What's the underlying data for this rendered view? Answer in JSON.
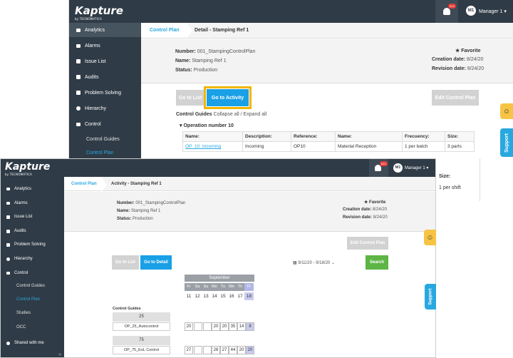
{
  "brand": {
    "logo": "Kapture",
    "tagline": "by TECNOMATICA"
  },
  "notifications": {
    "count": "613"
  },
  "user": {
    "initials": "M1",
    "name": "Manager 1",
    "caret": "▾"
  },
  "sidebar": {
    "items": [
      "Analytics",
      "Alarms",
      "Issue List",
      "Audits",
      "Problem Solving",
      "Hierarchy",
      "Control"
    ],
    "control_sub": [
      "Control Guides",
      "Control Plan",
      "Studies",
      "OCC"
    ],
    "extra": "Shared with me",
    "collapse": "«"
  },
  "back": {
    "breadcrumb": {
      "tab": "Control Plan",
      "current": "Detail - Stamping Ref 1"
    },
    "info": {
      "number_label": "Number:",
      "number": "001_StampingControlPlan",
      "name_label": "Name:",
      "name": "Stamping Ref 1",
      "status_label": "Status:",
      "status": "Production",
      "favorite": "Favorite",
      "creation_label": "Creation date:",
      "creation": "8/24/20",
      "revision_label": "Revision date:",
      "revision": "8/24/20"
    },
    "buttons": {
      "go_to_list": "Go to List",
      "go_to_activity": "Go to Activity",
      "edit": "Edit Control Plan"
    },
    "guides_header": {
      "title": "Control Guides",
      "toggle": "Collapse all / Expand all"
    },
    "operation": "Operation number 10",
    "table": {
      "headers": [
        "Name:",
        "Description:",
        "Reference:",
        "Name:",
        "Frecuency:",
        "Size:"
      ],
      "row": [
        "OP_10_Incoming",
        "Incoming",
        "OP10",
        "Material Reception",
        "1 per batch",
        "3 parts"
      ]
    },
    "peek": {
      "size": "Size:",
      "shift": "1 per shift"
    }
  },
  "front": {
    "breadcrumb": {
      "tab": "Control Plan",
      "current": "Activity - Stamping Ref 1"
    },
    "info": {
      "number_label": "Number:",
      "number": "001_StampingControlPlan",
      "name_label": "Name:",
      "name": "Stamping Ref 1",
      "status_label": "Status:",
      "status": "Production",
      "favorite": "Favorite",
      "creation_label": "Creation date:",
      "creation": "8/24/20",
      "revision_label": "Revision date:",
      "revision": "8/24/20"
    },
    "buttons": {
      "edit": "Edit Control Plan",
      "go_to_list": "Go to List",
      "go_to_detail": "Go to Detail",
      "search": "Search"
    },
    "date_range": "9/11/20 - 9/18/20",
    "calendar": {
      "month": "September",
      "day_names": [
        "Fr",
        "Sa",
        "Su",
        "Mo",
        "Tu",
        "We",
        "Th",
        "Fr"
      ],
      "days": [
        "11",
        "12",
        "13",
        "14",
        "15",
        "16",
        "17",
        "18"
      ]
    },
    "guides_title": "Control Guides",
    "guides": [
      {
        "count": "25",
        "name": "OP_25_Autocontrol",
        "cells": [
          "20",
          "",
          "",
          "20",
          "20",
          "35",
          "14",
          "8"
        ]
      },
      {
        "count": "75",
        "name": "OP_75_EoL Control",
        "cells": [
          "27",
          "",
          "",
          "26",
          "27",
          "44",
          "20",
          "20"
        ]
      }
    ]
  },
  "widgets": {
    "support": "Support",
    "smiley": "☺"
  }
}
